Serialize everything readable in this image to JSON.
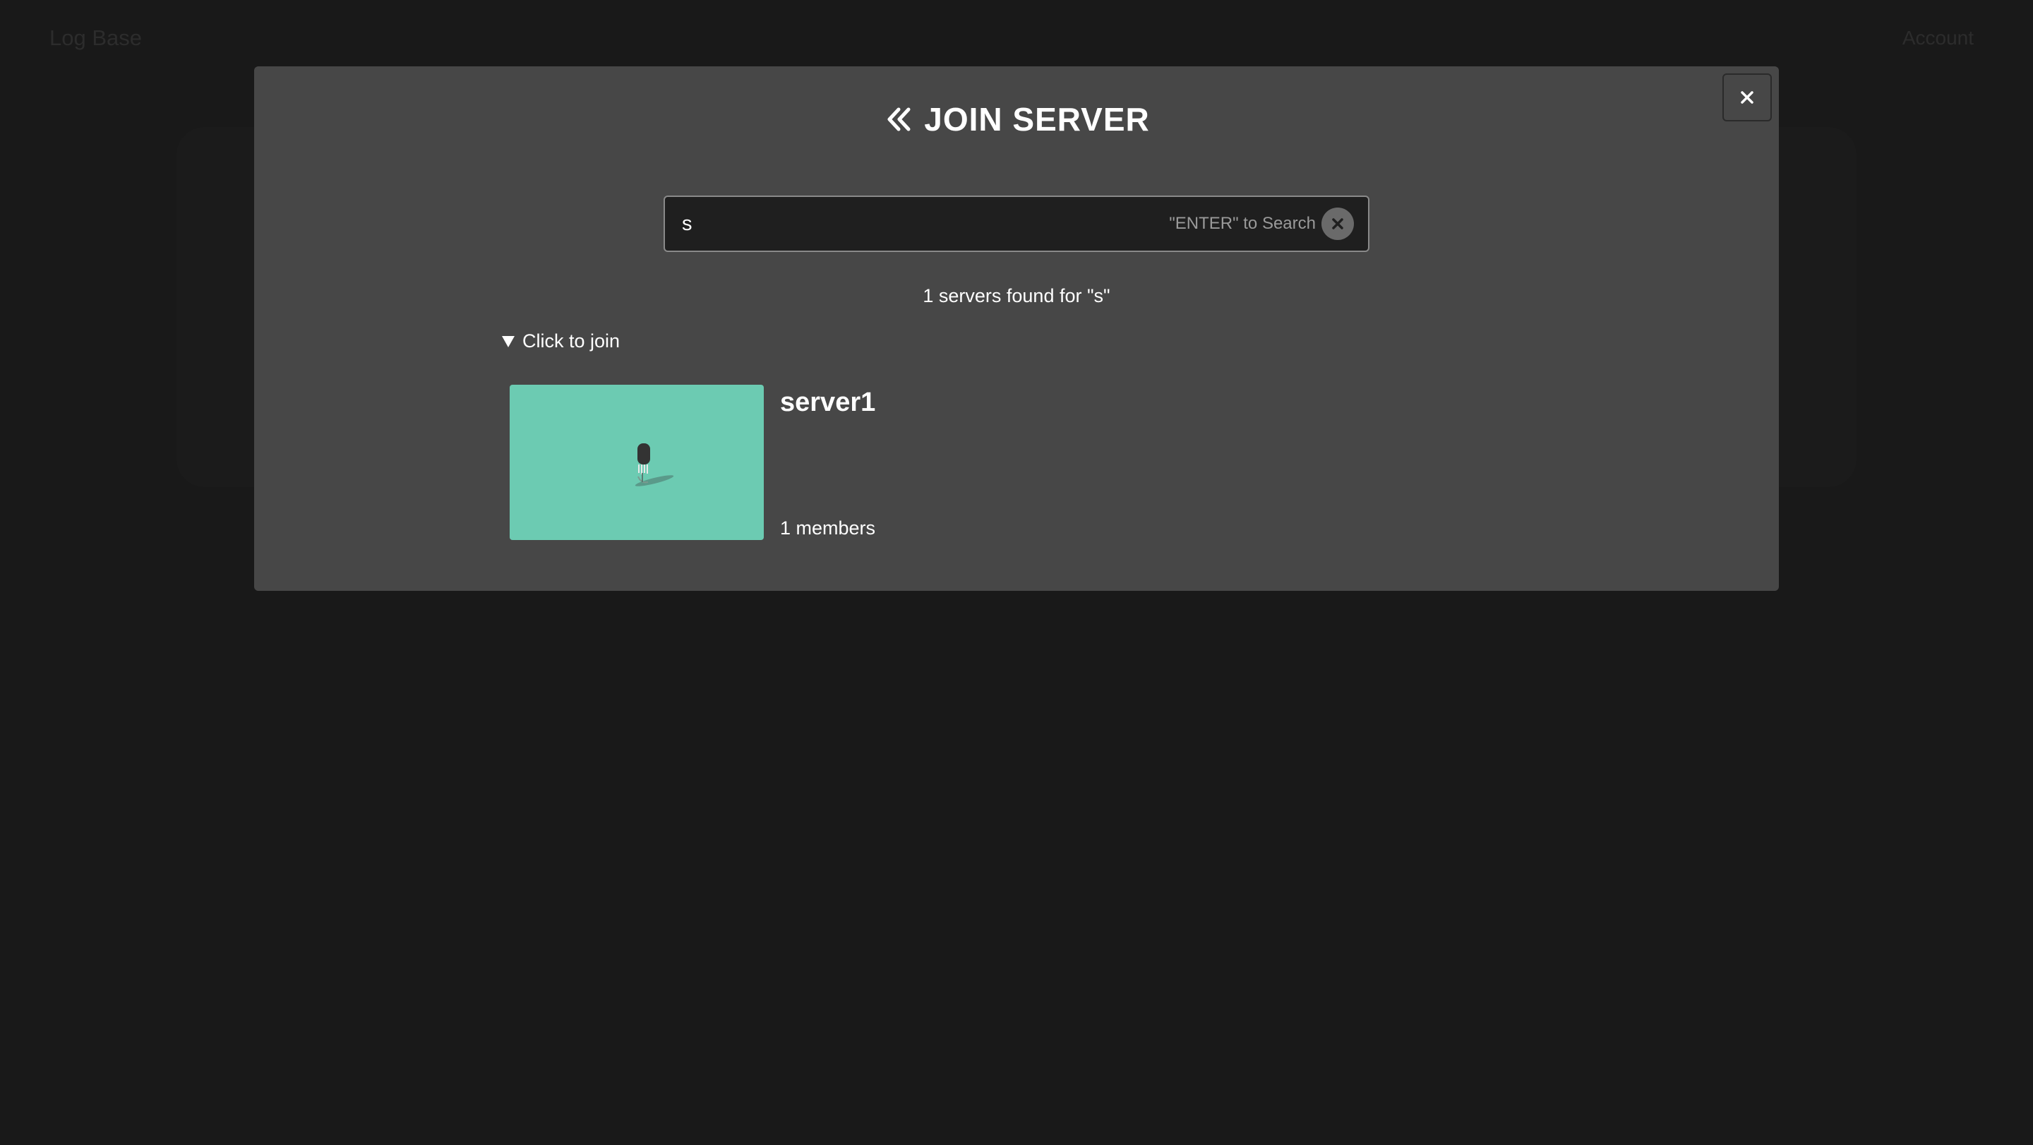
{
  "header": {
    "brand": "Log Base",
    "account_label": "Account"
  },
  "modal": {
    "title": "JOIN SERVER",
    "back_icon": "chevrons-left-icon",
    "close_icon": "close-icon",
    "search": {
      "value": "s",
      "placeholder": "",
      "hint": "\"ENTER\" to Search",
      "clear_icon": "clear-circle-icon"
    },
    "results_count": "1 servers found for \"s\"",
    "join_toggle": {
      "label": "Click to join",
      "icon": "triangle-down-icon"
    },
    "servers": [
      {
        "name": "server1",
        "members": "1 members",
        "thumb_color": "#6ccbb2"
      }
    ]
  },
  "colors": {
    "background": "#1c1c1c",
    "modal": "#474747",
    "accent": "#6ccbb2"
  }
}
